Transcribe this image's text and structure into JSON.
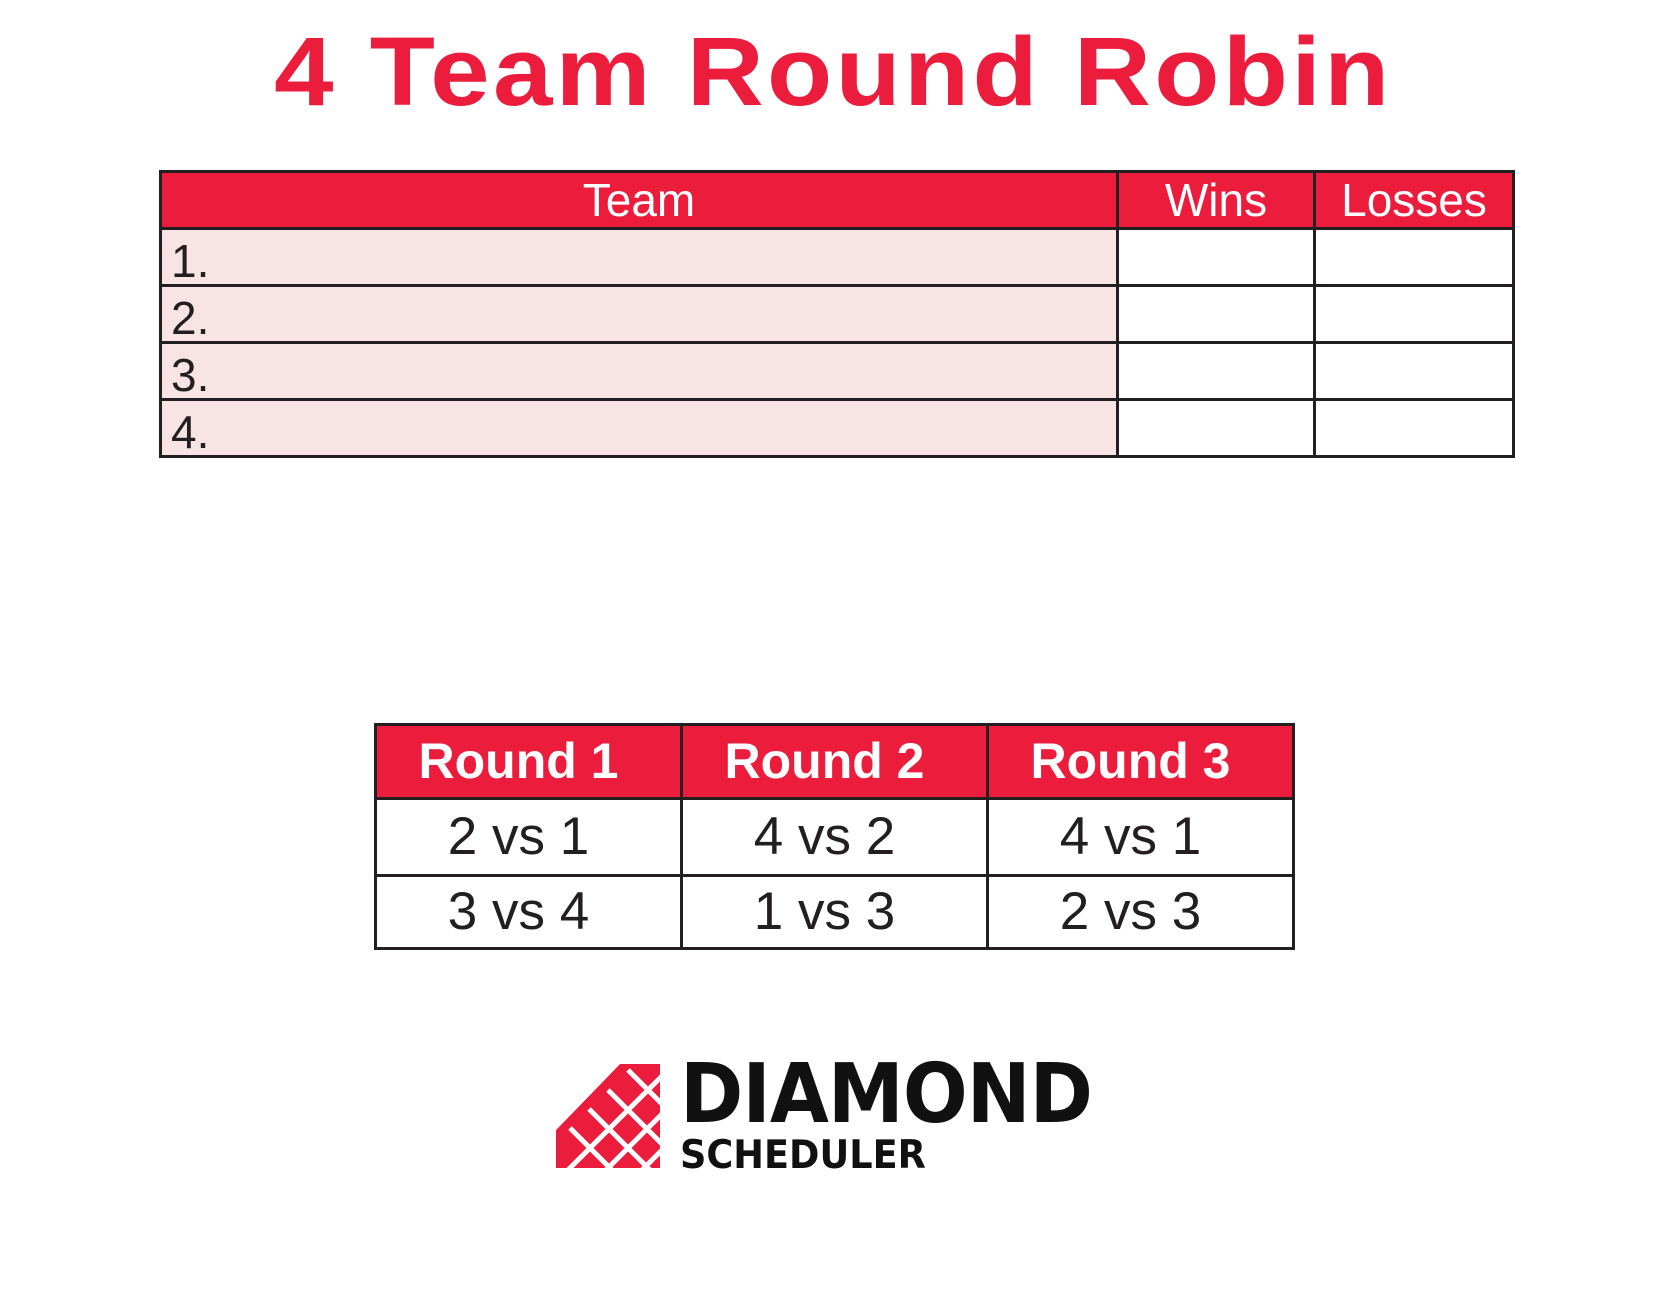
{
  "title": "4 Team Round Robin",
  "colors": {
    "accent": "#eb1c3c",
    "row_fill": "#f9e4e5",
    "border": "#231f20"
  },
  "standings": {
    "headers": [
      "Team",
      "Wins",
      "Losses"
    ],
    "rows": [
      {
        "team": "1.",
        "wins": "",
        "losses": ""
      },
      {
        "team": "2.",
        "wins": "",
        "losses": ""
      },
      {
        "team": "3.",
        "wins": "",
        "losses": ""
      },
      {
        "team": "4.",
        "wins": "",
        "losses": ""
      }
    ]
  },
  "rounds": {
    "headers": [
      "Round 1",
      "Round 2",
      "Round 3"
    ],
    "rows": [
      [
        "2 vs 1",
        "4 vs 2",
        "4 vs 1"
      ],
      [
        "3 vs 4",
        "1 vs 3",
        "2 vs 3"
      ]
    ]
  },
  "logo": {
    "icon": "diamond-grid-icon",
    "line1": "DIAMOND",
    "line2": "SCHEDULER"
  }
}
